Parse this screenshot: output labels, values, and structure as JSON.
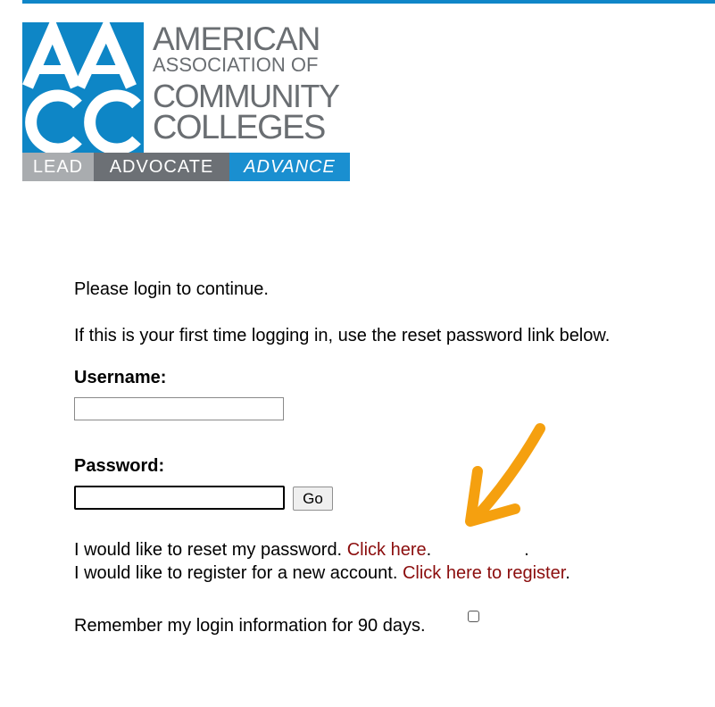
{
  "logo": {
    "line1": "AMERICAN",
    "line2": "ASSOCIATION OF",
    "line3": "COMMUNITY",
    "line4": "COLLEGES",
    "tagline": [
      "LEAD",
      "ADVOCATE",
      "ADVANCE"
    ]
  },
  "intro": {
    "prompt": "Please login to continue.",
    "first_time": "If this is your first time logging in, use the reset password link below."
  },
  "form": {
    "username_label": "Username:",
    "username_value": "",
    "password_label": "Password:",
    "password_value": "",
    "go_label": "Go"
  },
  "links": {
    "reset_text": "I would like to reset my password. ",
    "reset_link": "Click here",
    "reset_suffix": ".",
    "reset_trailing": ".",
    "register_text": "I would like to register for a new account. ",
    "register_link": "Click here to register",
    "register_suffix": "."
  },
  "remember": {
    "label": "Remember my login information for 90 days.",
    "checked": false
  },
  "colors": {
    "top_bar": "#0f86c8",
    "brand_blue": "#0e86c6",
    "link_red": "#8b0d0d",
    "annotation_arrow": "#f5a00f"
  }
}
